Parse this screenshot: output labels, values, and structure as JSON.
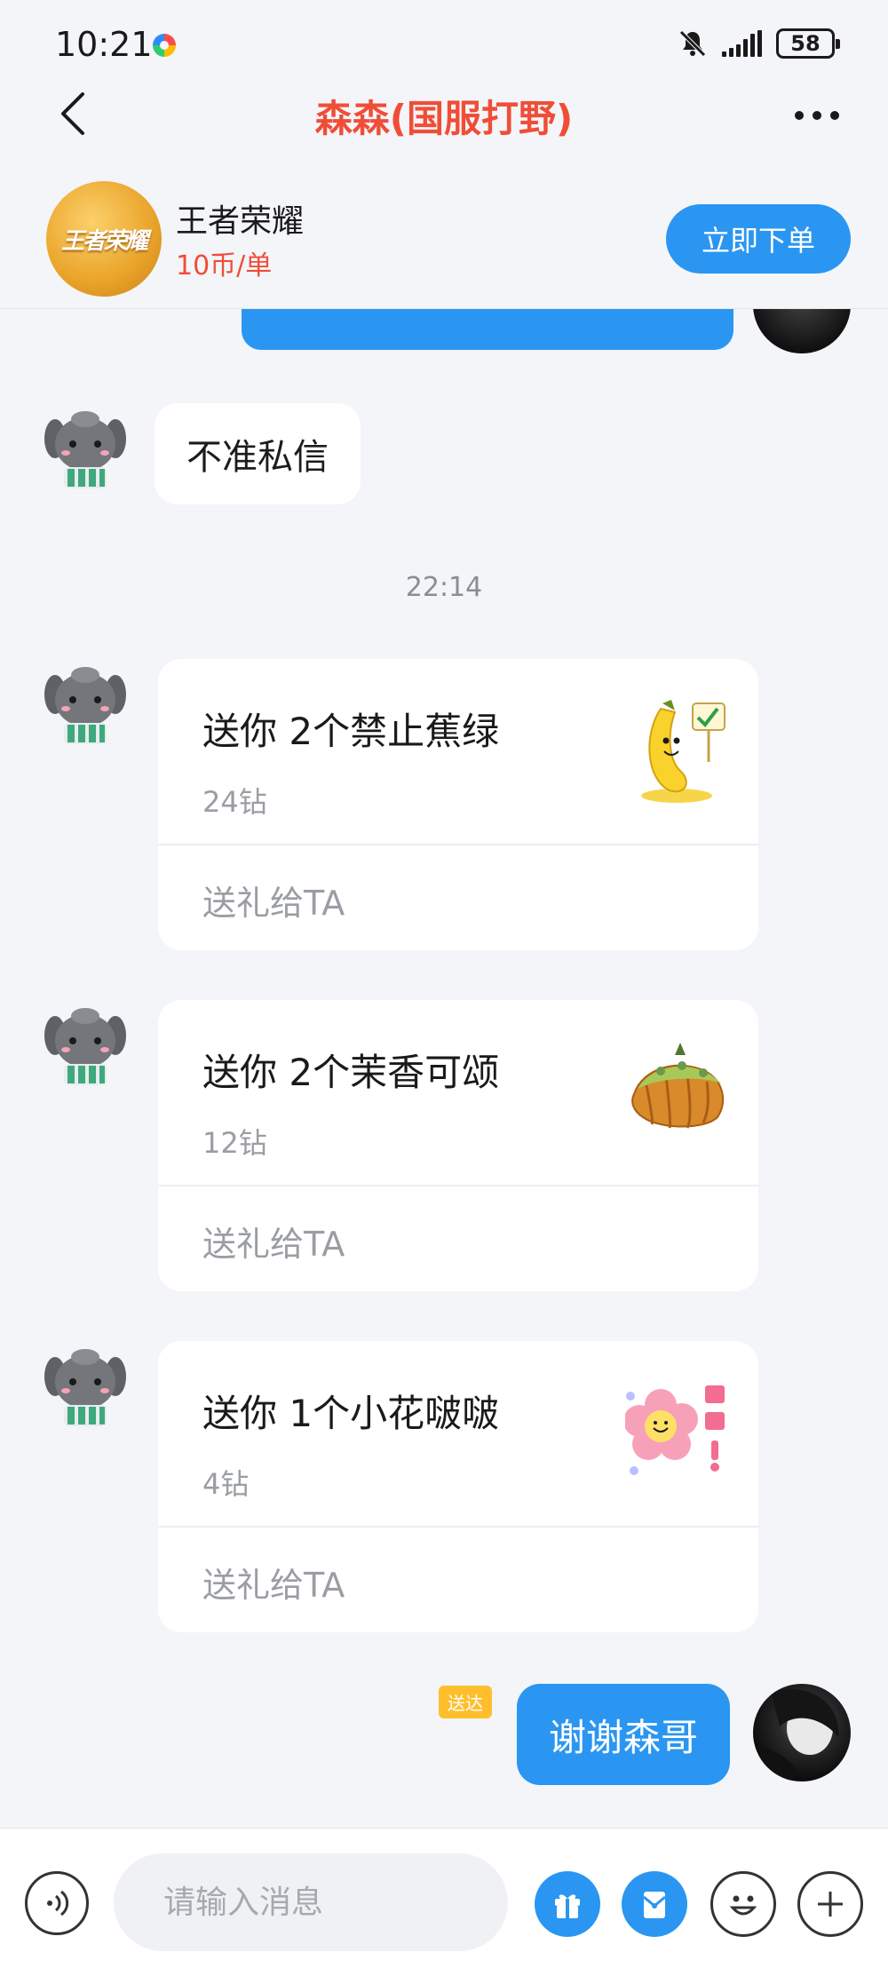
{
  "status": {
    "time": "10:21",
    "battery": "58"
  },
  "header": {
    "title": "森森(国服打野)"
  },
  "game": {
    "logo_text": "王者荣耀",
    "name": "王者荣耀",
    "price": "10币/单",
    "order_label": "立即下单"
  },
  "chat": {
    "message1": "不准私信",
    "timestamp": "22:14",
    "gifts": [
      {
        "title": "送你 2个禁止蕉绿",
        "price": "24钻",
        "action": "送礼给TA",
        "icon": "banana-sticker"
      },
      {
        "title": "送你 2个茉香可颂",
        "price": "12钻",
        "action": "送礼给TA",
        "icon": "croissant-sticker"
      },
      {
        "title": "送你 1个小花啵啵",
        "price": "4钻",
        "action": "送礼给TA",
        "icon": "flower-sticker"
      }
    ],
    "sent_badge": "送达",
    "sent_message": "谢谢森哥"
  },
  "input": {
    "placeholder": "请输入消息"
  },
  "colors": {
    "accent": "#2a96f2",
    "title_red": "#f04d37",
    "badge": "#ffbf2c"
  }
}
